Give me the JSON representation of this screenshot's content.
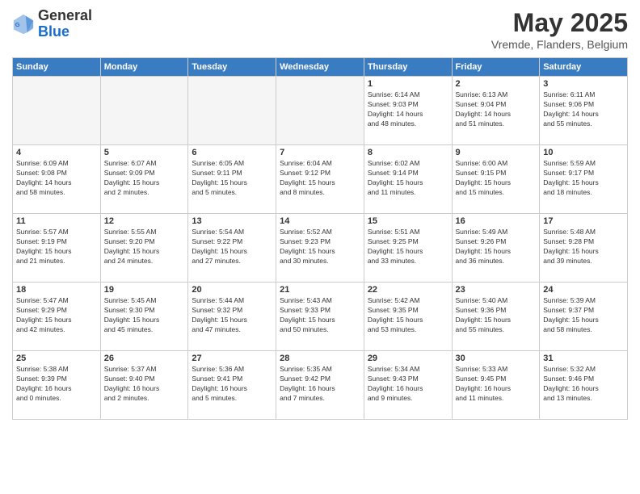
{
  "header": {
    "logo_general": "General",
    "logo_blue": "Blue",
    "month_title": "May 2025",
    "location": "Vremde, Flanders, Belgium"
  },
  "weekdays": [
    "Sunday",
    "Monday",
    "Tuesday",
    "Wednesday",
    "Thursday",
    "Friday",
    "Saturday"
  ],
  "weeks": [
    [
      {
        "day": "",
        "info": ""
      },
      {
        "day": "",
        "info": ""
      },
      {
        "day": "",
        "info": ""
      },
      {
        "day": "",
        "info": ""
      },
      {
        "day": "1",
        "info": "Sunrise: 6:14 AM\nSunset: 9:03 PM\nDaylight: 14 hours\nand 48 minutes."
      },
      {
        "day": "2",
        "info": "Sunrise: 6:13 AM\nSunset: 9:04 PM\nDaylight: 14 hours\nand 51 minutes."
      },
      {
        "day": "3",
        "info": "Sunrise: 6:11 AM\nSunset: 9:06 PM\nDaylight: 14 hours\nand 55 minutes."
      }
    ],
    [
      {
        "day": "4",
        "info": "Sunrise: 6:09 AM\nSunset: 9:08 PM\nDaylight: 14 hours\nand 58 minutes."
      },
      {
        "day": "5",
        "info": "Sunrise: 6:07 AM\nSunset: 9:09 PM\nDaylight: 15 hours\nand 2 minutes."
      },
      {
        "day": "6",
        "info": "Sunrise: 6:05 AM\nSunset: 9:11 PM\nDaylight: 15 hours\nand 5 minutes."
      },
      {
        "day": "7",
        "info": "Sunrise: 6:04 AM\nSunset: 9:12 PM\nDaylight: 15 hours\nand 8 minutes."
      },
      {
        "day": "8",
        "info": "Sunrise: 6:02 AM\nSunset: 9:14 PM\nDaylight: 15 hours\nand 11 minutes."
      },
      {
        "day": "9",
        "info": "Sunrise: 6:00 AM\nSunset: 9:15 PM\nDaylight: 15 hours\nand 15 minutes."
      },
      {
        "day": "10",
        "info": "Sunrise: 5:59 AM\nSunset: 9:17 PM\nDaylight: 15 hours\nand 18 minutes."
      }
    ],
    [
      {
        "day": "11",
        "info": "Sunrise: 5:57 AM\nSunset: 9:19 PM\nDaylight: 15 hours\nand 21 minutes."
      },
      {
        "day": "12",
        "info": "Sunrise: 5:55 AM\nSunset: 9:20 PM\nDaylight: 15 hours\nand 24 minutes."
      },
      {
        "day": "13",
        "info": "Sunrise: 5:54 AM\nSunset: 9:22 PM\nDaylight: 15 hours\nand 27 minutes."
      },
      {
        "day": "14",
        "info": "Sunrise: 5:52 AM\nSunset: 9:23 PM\nDaylight: 15 hours\nand 30 minutes."
      },
      {
        "day": "15",
        "info": "Sunrise: 5:51 AM\nSunset: 9:25 PM\nDaylight: 15 hours\nand 33 minutes."
      },
      {
        "day": "16",
        "info": "Sunrise: 5:49 AM\nSunset: 9:26 PM\nDaylight: 15 hours\nand 36 minutes."
      },
      {
        "day": "17",
        "info": "Sunrise: 5:48 AM\nSunset: 9:28 PM\nDaylight: 15 hours\nand 39 minutes."
      }
    ],
    [
      {
        "day": "18",
        "info": "Sunrise: 5:47 AM\nSunset: 9:29 PM\nDaylight: 15 hours\nand 42 minutes."
      },
      {
        "day": "19",
        "info": "Sunrise: 5:45 AM\nSunset: 9:30 PM\nDaylight: 15 hours\nand 45 minutes."
      },
      {
        "day": "20",
        "info": "Sunrise: 5:44 AM\nSunset: 9:32 PM\nDaylight: 15 hours\nand 47 minutes."
      },
      {
        "day": "21",
        "info": "Sunrise: 5:43 AM\nSunset: 9:33 PM\nDaylight: 15 hours\nand 50 minutes."
      },
      {
        "day": "22",
        "info": "Sunrise: 5:42 AM\nSunset: 9:35 PM\nDaylight: 15 hours\nand 53 minutes."
      },
      {
        "day": "23",
        "info": "Sunrise: 5:40 AM\nSunset: 9:36 PM\nDaylight: 15 hours\nand 55 minutes."
      },
      {
        "day": "24",
        "info": "Sunrise: 5:39 AM\nSunset: 9:37 PM\nDaylight: 15 hours\nand 58 minutes."
      }
    ],
    [
      {
        "day": "25",
        "info": "Sunrise: 5:38 AM\nSunset: 9:39 PM\nDaylight: 16 hours\nand 0 minutes."
      },
      {
        "day": "26",
        "info": "Sunrise: 5:37 AM\nSunset: 9:40 PM\nDaylight: 16 hours\nand 2 minutes."
      },
      {
        "day": "27",
        "info": "Sunrise: 5:36 AM\nSunset: 9:41 PM\nDaylight: 16 hours\nand 5 minutes."
      },
      {
        "day": "28",
        "info": "Sunrise: 5:35 AM\nSunset: 9:42 PM\nDaylight: 16 hours\nand 7 minutes."
      },
      {
        "day": "29",
        "info": "Sunrise: 5:34 AM\nSunset: 9:43 PM\nDaylight: 16 hours\nand 9 minutes."
      },
      {
        "day": "30",
        "info": "Sunrise: 5:33 AM\nSunset: 9:45 PM\nDaylight: 16 hours\nand 11 minutes."
      },
      {
        "day": "31",
        "info": "Sunrise: 5:32 AM\nSunset: 9:46 PM\nDaylight: 16 hours\nand 13 minutes."
      }
    ]
  ]
}
